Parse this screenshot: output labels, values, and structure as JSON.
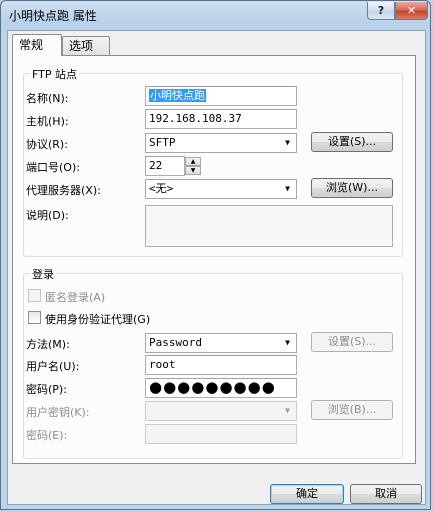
{
  "window": {
    "title": "小明快点跑 属性"
  },
  "tabs": [
    {
      "label": "常规",
      "active": true
    },
    {
      "label": "选项",
      "active": false
    }
  ],
  "ftp_site": {
    "group_title": "FTP 站点",
    "name_label": "名称(N):",
    "name_value": "小明快点跑",
    "host_label": "主机(H):",
    "host_value": "192.168.108.37",
    "protocol_label": "协议(R):",
    "protocol_value": "SFTP",
    "settings_button": "设置(S)...",
    "port_label": "端口号(O):",
    "port_value": "22",
    "proxy_label": "代理服务器(X):",
    "proxy_value": "<无>",
    "browse_button": "浏览(W)...",
    "description_label": "说明(D):",
    "description_value": ""
  },
  "login": {
    "group_title": "登录",
    "anonymous_label": "匿名登录(A)",
    "use_proxy_auth_label": "使用身份验证代理(G)",
    "method_label": "方法(M):",
    "method_value": "Password",
    "method_settings_button": "设置(S)...",
    "username_label": "用户名(U):",
    "username_value": "root",
    "password_label": "密码(P):",
    "password_value": "●●●●●●●●●",
    "user_key_label": "用户密钥(K):",
    "user_key_value": "",
    "key_browse_button": "浏览(B)...",
    "passphrase_label": "密码(E):",
    "passphrase_value": ""
  },
  "footer": {
    "ok_button": "确定",
    "cancel_button": "取消"
  },
  "icons": {
    "help": "?",
    "close": "✕",
    "dropdown": "▼",
    "spin_up": "▲",
    "spin_down": "▼"
  },
  "colors": {
    "selection": "#3399ff",
    "close_button": "#c3412a"
  }
}
